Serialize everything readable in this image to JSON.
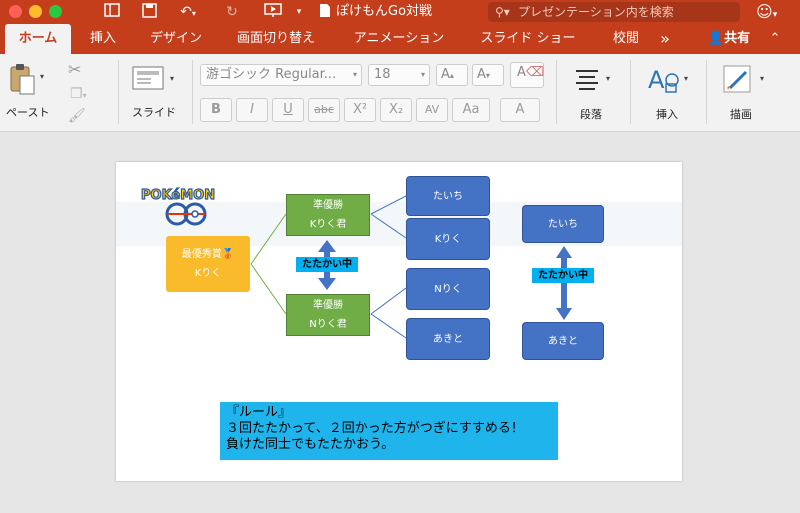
{
  "titlebar": {
    "doc_title": "ぽけもんGo対戦",
    "search_placeholder": "プレゼンテーション内を検索",
    "bg_color": "#c43e1c"
  },
  "tabs": [
    "ホーム",
    "挿入",
    "デザイン",
    "画面切り替え",
    "アニメーション",
    "スライド ショー",
    "校閲"
  ],
  "tab_more": "»",
  "share_label": "共有",
  "ribbon": {
    "paste_label": "ペースト",
    "slide_label": "スライド",
    "font_name": "游ゴシック Regular...",
    "font_size": "18",
    "paragraph_label": "段落",
    "insert_label": "挿入",
    "draw_label": "描画",
    "format_buttons": [
      "B",
      "I",
      "U",
      "abc",
      "X²",
      "X₂",
      "AV",
      "Aa",
      "A"
    ]
  },
  "slide": {
    "winner_title": "最優秀賞🥉",
    "winner_name": "Kりく",
    "semi1_title": "準優勝",
    "semi1_name": "Kりく君",
    "semi2_title": "準優勝",
    "semi2_name": "Nりく君",
    "fighting_label": "たたかい中",
    "players": [
      "たいち",
      "Kりく",
      "Nりく",
      "あきと"
    ],
    "right_top": "たいち",
    "right_bottom": "あきと",
    "right_fighting": "たたかい中",
    "rule_title": "『ルール』",
    "rule_line1": "３回たたかって、２回かった方がつぎにすすめる！",
    "rule_line2": "負けた同士でもたたかおう。",
    "logo_text_top": "POKéMON",
    "logo_text_bottom": "GO"
  }
}
